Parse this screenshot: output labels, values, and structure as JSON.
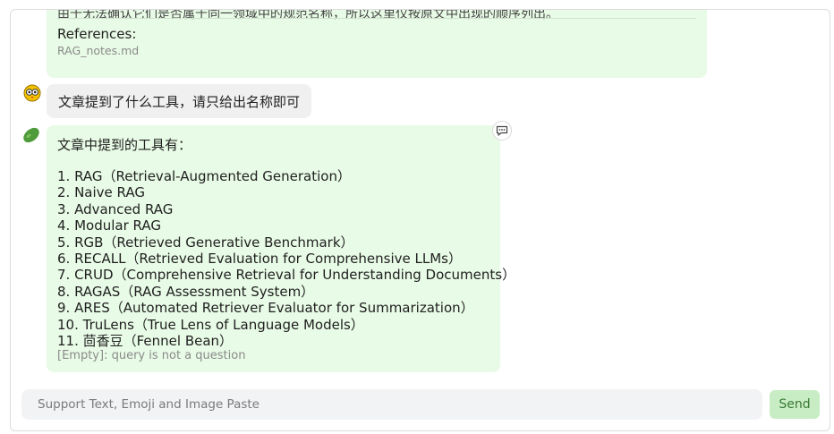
{
  "previous_message": {
    "cut_text": "由于无法确认它们是否属于同一领域中的规范名称，所以这里仅按原文中出现的顺序列出。",
    "references_label": "References:",
    "reference_file": "RAG_notes.md"
  },
  "user_message": {
    "text": "文章提到了什么工具，请只给出名称即可"
  },
  "bot_message": {
    "lead": "文章中提到的工具有：",
    "items": [
      "1. RAG（Retrieval-Augmented Generation）",
      "2. Naive RAG",
      "3. Advanced RAG",
      "4. Modular RAG",
      "5. RGB（Retrieved Generative Benchmark）",
      "6. RECALL（Retrieved Evaluation for Comprehensive LLMs）",
      "7. CRUD（Comprehensive Retrieval for Understanding Documents）",
      "8. RAGAS（RAG Assessment System）",
      "9. ARES（Automated Retriever Evaluator for Summarization）",
      "10. TruLens（True Lens of Language Models）",
      "11. 茴香豆（Fennel Bean）"
    ],
    "empty_note": "[Empty]: query is not a question"
  },
  "composer": {
    "placeholder": "Support Text, Emoji and Image Paste",
    "send_label": "Send"
  },
  "icons": {
    "user_avatar": "owl-face-icon",
    "bot_avatar": "bean-icon",
    "copy": "chat-bubble-icon"
  },
  "colors": {
    "bot_bubble": "#e8fbe6",
    "user_bubble": "#f0f0f0",
    "send_button": "#c8ecc4"
  }
}
